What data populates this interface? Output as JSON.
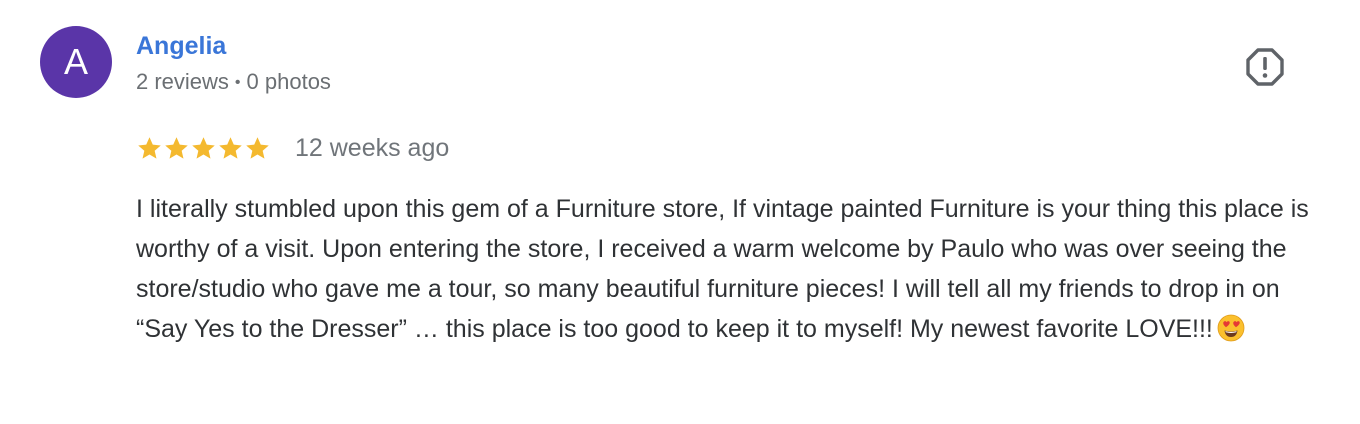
{
  "reviewer": {
    "initial": "A",
    "name": "Angelia",
    "reviews_count": "2 reviews",
    "separator": "•",
    "photos_count": "0 photos",
    "avatar_color": "#5a35a8",
    "name_color": "#3a76d8"
  },
  "rating": {
    "stars": 5,
    "max_stars": 5,
    "star_color": "#f4b92f"
  },
  "review": {
    "date": "12 weeks ago",
    "text": "I literally stumbled upon this gem of a Furniture store, If vintage painted Furniture is your thing this place is worthy of a visit. Upon entering the store, I received a warm welcome by Paulo who was over seeing the store/studio who gave me a tour, so many beautiful furniture pieces! I will tell all my friends to drop in on “Say Yes to the Dresser” … this place is too good to keep it to myself! My newest favorite LOVE!!!",
    "emoji": "smiling-face-with-heart-eyes"
  },
  "actions": {
    "report_icon": "report-flag-icon"
  }
}
